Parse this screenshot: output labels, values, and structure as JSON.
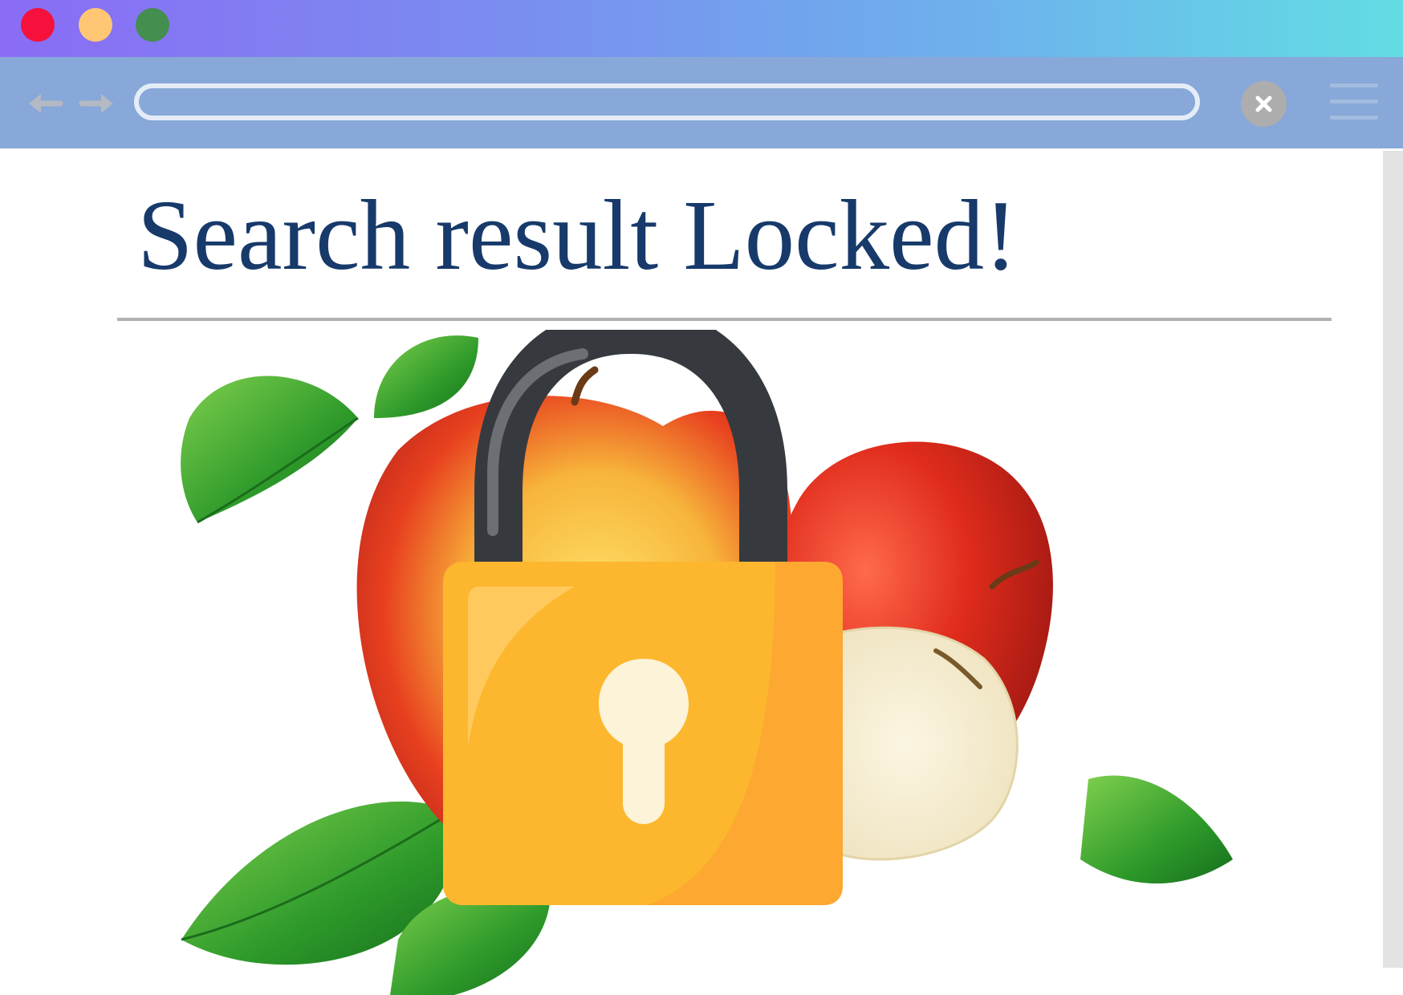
{
  "window": {
    "controls": [
      "close-dot",
      "minimize-dot",
      "maximize-dot"
    ],
    "titlebar_gradient": [
      "#8a6cf5",
      "#62dde4"
    ]
  },
  "toolbar": {
    "address_value": "",
    "back_icon": "arrow-left-icon",
    "forward_icon": "arrow-right-icon",
    "close_icon": "close-icon",
    "menu_icon": "hamburger-menu-icon"
  },
  "page": {
    "title": "Search result Locked!"
  },
  "hero": {
    "image": "apples-with-padlock-illustration",
    "lock_icon": "padlock-icon"
  },
  "colors": {
    "title": "#173a6b",
    "toolbar": "#87a8d8",
    "lock_body": "#fdb72e",
    "lock_shackle": "#363a3f"
  }
}
